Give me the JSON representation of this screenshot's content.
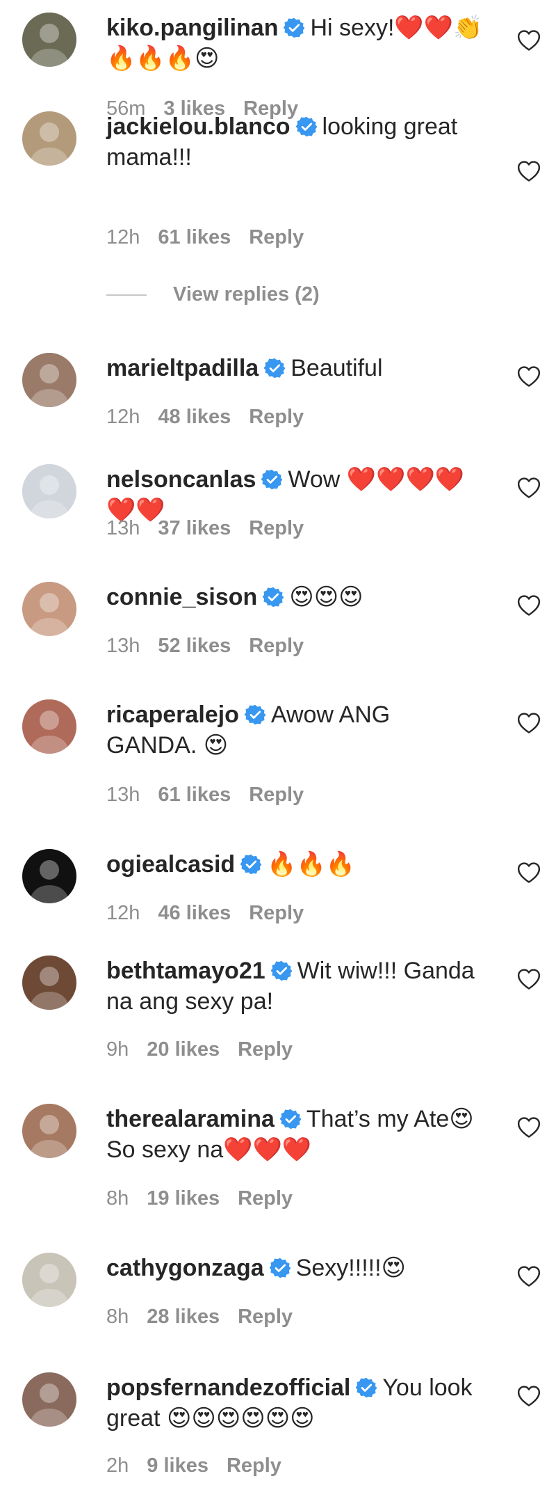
{
  "comments": [
    {
      "username": "kiko.pangilinan",
      "text": "Hi sexy!❤️❤️👏🔥🔥🔥😍",
      "time": "56m",
      "likes": "3 likes",
      "reply": "Reply",
      "avatar_color": "#6a6a55"
    },
    {
      "username": "jackielou.blanco",
      "text": "looking great mama!!!",
      "time": "12h",
      "likes": "61 likes",
      "reply": "Reply",
      "avatar_color": "#b39a7a"
    },
    {
      "username": "marieltpadilla",
      "text": "Beautiful",
      "time": "12h",
      "likes": "48 likes",
      "reply": "Reply",
      "avatar_color": "#9a7a68"
    },
    {
      "username": "nelsoncanlas",
      "text": "Wow ❤️❤️❤️❤️❤️❤️",
      "time": "13h",
      "likes": "37 likes",
      "reply": "Reply",
      "avatar_color": "#d0d6dc"
    },
    {
      "username": "connie_sison",
      "text": "😍😍😍",
      "time": "13h",
      "likes": "52 likes",
      "reply": "Reply",
      "avatar_color": "#c89a82"
    },
    {
      "username": "ricaperalejo",
      "text": "Awow ANG GANDA. 😍",
      "time": "13h",
      "likes": "61 likes",
      "reply": "Reply",
      "avatar_color": "#b06a5a"
    },
    {
      "username": "ogiealcasid",
      "text": "🔥🔥🔥",
      "time": "12h",
      "likes": "46 likes",
      "reply": "Reply",
      "avatar_color": "#111111"
    },
    {
      "username": "bethtamayo21",
      "text": "Wit wiw!!! Ganda na ang sexy pa!",
      "time": "9h",
      "likes": "20 likes",
      "reply": "Reply",
      "avatar_color": "#6e4a36"
    },
    {
      "username": "therealaramina",
      "text": "That’s my Ate😍 So sexy na❤️❤️❤️",
      "time": "8h",
      "likes": "19 likes",
      "reply": "Reply",
      "avatar_color": "#a67a62"
    },
    {
      "username": "cathygonzaga",
      "text": "Sexy!!!!!😍",
      "time": "8h",
      "likes": "28 likes",
      "reply": "Reply",
      "avatar_color": "#c9c4b8"
    },
    {
      "username": "popsfernandezofficial",
      "text": "You look great 😍😍😍😍😍😍",
      "time": "2h",
      "likes": "9 likes",
      "reply": "Reply",
      "avatar_color": "#8a6a5c"
    }
  ],
  "view_replies": "View replies (2)",
  "colors": {
    "verified": "#3897f0",
    "meta_text": "#8e8e8e",
    "username": "#262626"
  },
  "icons": {
    "verified": "verified-badge-icon",
    "like": "heart-outline-icon"
  }
}
